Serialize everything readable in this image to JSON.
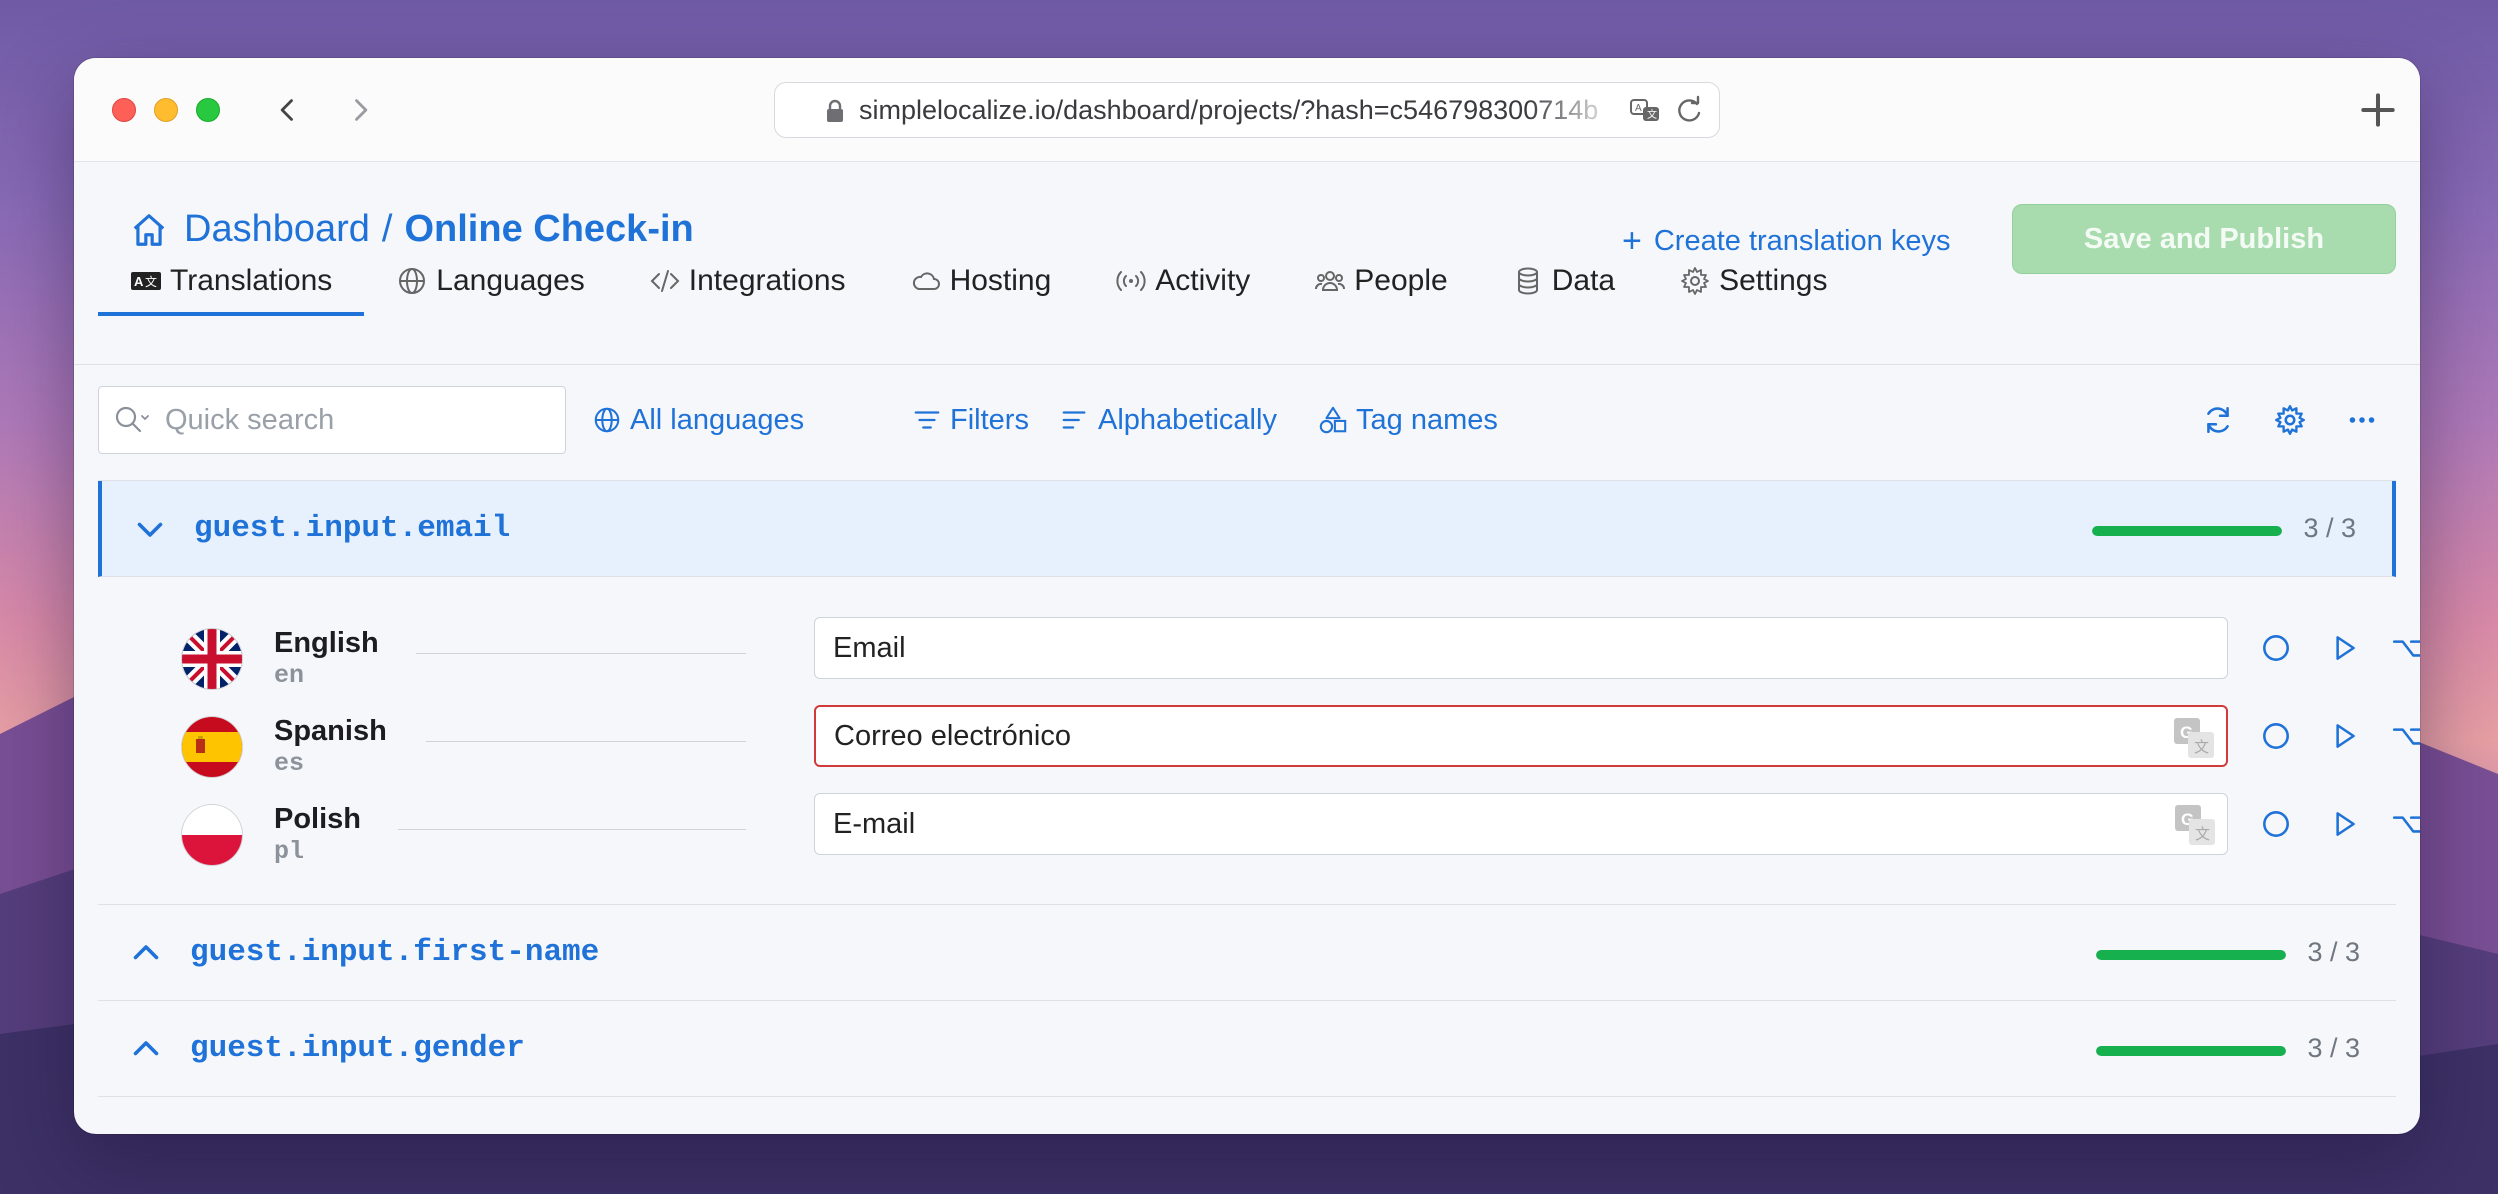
{
  "browser": {
    "url": "simplelocalize.io/dashboard/projects/?hash=c546798300714b"
  },
  "header": {
    "breadcrumb_root": "Dashboard",
    "breadcrumb_separator": "/",
    "breadcrumb_current": "Online Check-in",
    "create_keys_label": "Create translation keys",
    "save_publish_label": "Save and Publish"
  },
  "tabs": [
    {
      "label": "Translations",
      "icon": "translations-icon",
      "active": true
    },
    {
      "label": "Languages",
      "icon": "globe-icon"
    },
    {
      "label": "Integrations",
      "icon": "code-icon"
    },
    {
      "label": "Hosting",
      "icon": "cloud-icon"
    },
    {
      "label": "Activity",
      "icon": "broadcast-icon"
    },
    {
      "label": "People",
      "icon": "people-icon"
    },
    {
      "label": "Data",
      "icon": "database-icon"
    },
    {
      "label": "Settings",
      "icon": "gear-icon"
    }
  ],
  "toolbar": {
    "search_placeholder": "Quick search",
    "all_languages": "All languages",
    "filters": "Filters",
    "sort": "Alphabetically",
    "tag_names": "Tag names"
  },
  "keys": [
    {
      "name": "guest.input.email",
      "progress": 1.0,
      "count": "3 / 3",
      "expanded": true,
      "translations": [
        {
          "language": "English",
          "code": "en",
          "value": "Email"
        },
        {
          "language": "Spanish",
          "code": "es",
          "value": "Correo electrónico"
        },
        {
          "language": "Polish",
          "code": "pl",
          "value": "E-mail"
        }
      ]
    },
    {
      "name": "guest.input.first-name",
      "progress": 1.0,
      "count": "3 / 3",
      "expanded": false
    },
    {
      "name": "guest.input.gender",
      "progress": 1.0,
      "count": "3 / 3",
      "expanded": false
    }
  ],
  "colors": {
    "accent": "#1f72d8",
    "progress": "#16b04f",
    "save_button": "#a8dcae",
    "error_border": "#d13a3a"
  }
}
